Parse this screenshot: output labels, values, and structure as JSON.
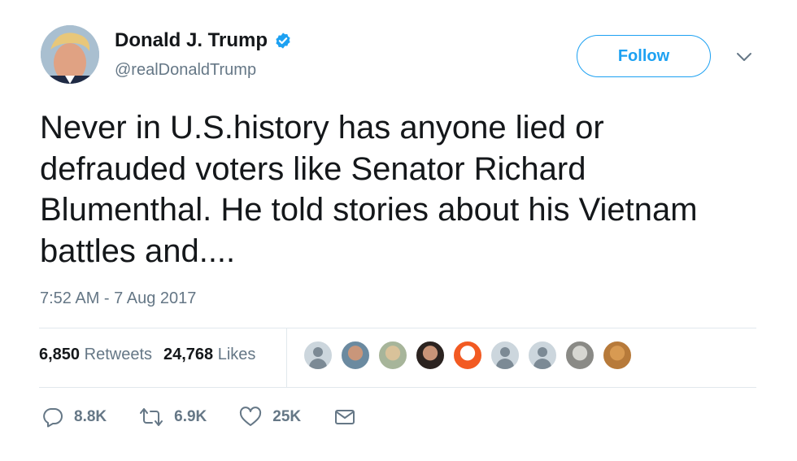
{
  "author": {
    "display_name": "Donald J. Trump",
    "handle": "@realDonaldTrump",
    "verified": true
  },
  "follow_button": {
    "label": "Follow"
  },
  "tweet": {
    "text_lines": [
      "Never in U.S.history has anyone lied or",
      "defrauded voters like Senator Richard",
      "Blumenthal. He told stories about his Vietnam",
      "battles and...."
    ],
    "timestamp": "7:52 AM - 7 Aug 2017"
  },
  "stats": {
    "retweets_count": "6,850",
    "retweets_label": "Retweets",
    "likes_count": "24,768",
    "likes_label": "Likes"
  },
  "likers": [
    {
      "kind": "default"
    },
    {
      "kind": "photo",
      "colors": [
        "#6b8aa0",
        "#c9967a"
      ]
    },
    {
      "kind": "photo",
      "colors": [
        "#a7b59a",
        "#d9c29a"
      ]
    },
    {
      "kind": "photo",
      "colors": [
        "#2b2320",
        "#c89478"
      ]
    },
    {
      "kind": "photo",
      "colors": [
        "#f25a22",
        "#ffffff"
      ]
    },
    {
      "kind": "default"
    },
    {
      "kind": "default"
    },
    {
      "kind": "photo",
      "colors": [
        "#8a8a86",
        "#d7d7d2"
      ]
    },
    {
      "kind": "photo",
      "colors": [
        "#b77a3a",
        "#d89a52"
      ]
    }
  ],
  "actions": {
    "reply_count": "8.8K",
    "retweet_count": "6.9K",
    "like_count": "25K"
  },
  "colors": {
    "accent": "#1da1f2",
    "text": "#14171a",
    "muted": "#657786",
    "divider": "#e1e8ed"
  },
  "icons": [
    "verified-badge-icon",
    "chevron-down-icon",
    "reply-icon",
    "retweet-icon",
    "heart-icon",
    "message-icon"
  ]
}
